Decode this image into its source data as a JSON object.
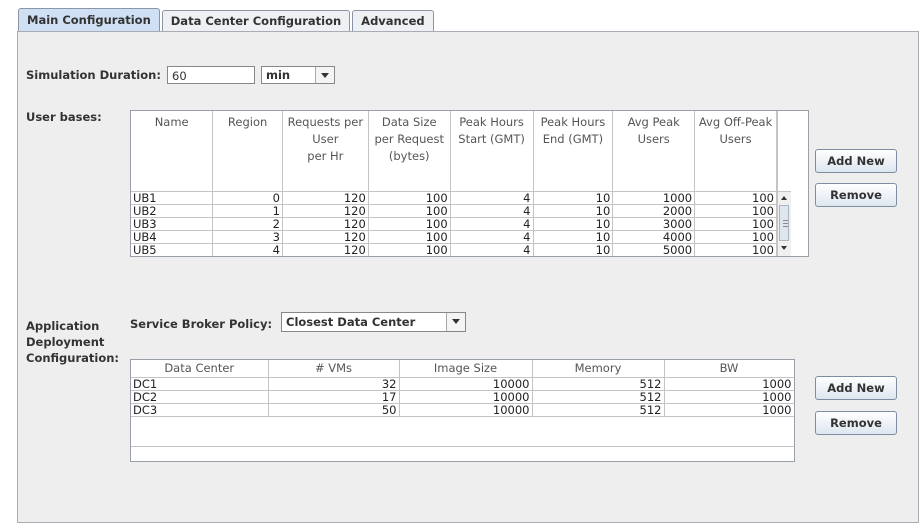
{
  "tabs": [
    "Main Configuration",
    "Data Center Configuration",
    "Advanced"
  ],
  "simulation": {
    "label": "Simulation Duration:",
    "value": "60",
    "unit": "min"
  },
  "user_bases": {
    "label": "User bases:",
    "headers": [
      [
        "Name"
      ],
      [
        "Region"
      ],
      [
        "Requests per",
        "User",
        "per Hr"
      ],
      [
        "Data Size",
        "per Request",
        "(bytes)"
      ],
      [
        "Peak Hours",
        "Start (GMT)"
      ],
      [
        "Peak Hours",
        "End (GMT)"
      ],
      [
        "Avg Peak",
        "Users"
      ],
      [
        "Avg Off-Peak",
        "Users"
      ]
    ],
    "rows": [
      [
        "UB1",
        "0",
        "120",
        "100",
        "4",
        "10",
        "1000",
        "100"
      ],
      [
        "UB2",
        "1",
        "120",
        "100",
        "4",
        "10",
        "2000",
        "100"
      ],
      [
        "UB3",
        "2",
        "120",
        "100",
        "4",
        "10",
        "3000",
        "100"
      ],
      [
        "UB4",
        "3",
        "120",
        "100",
        "4",
        "10",
        "4000",
        "100"
      ],
      [
        "UB5",
        "4",
        "120",
        "100",
        "4",
        "10",
        "5000",
        "100"
      ]
    ],
    "add_label": "Add New",
    "remove_label": "Remove"
  },
  "deployment": {
    "label_lines": [
      "Application",
      "Deployment",
      "Configuration:"
    ],
    "broker_label": "Service Broker Policy:",
    "broker_value": "Closest Data Center",
    "headers": [
      "Data Center",
      "# VMs",
      "Image Size",
      "Memory",
      "BW"
    ],
    "rows": [
      [
        "DC1",
        "32",
        "10000",
        "512",
        "1000"
      ],
      [
        "DC2",
        "17",
        "10000",
        "512",
        "1000"
      ],
      [
        "DC3",
        "50",
        "10000",
        "512",
        "1000"
      ]
    ],
    "add_label": "Add New",
    "remove_label": "Remove"
  }
}
